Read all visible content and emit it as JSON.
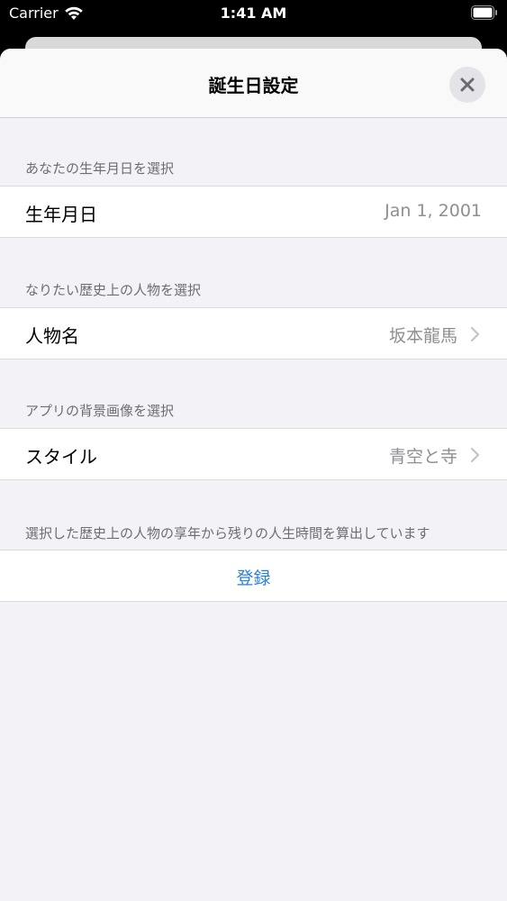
{
  "status_bar": {
    "carrier": "Carrier",
    "time": "1:41 AM"
  },
  "nav": {
    "title": "誕生日設定"
  },
  "sections": {
    "birthday_header": "あなたの生年月日を選択",
    "birthday_label": "生年月日",
    "birthday_value": "Jan 1, 2001",
    "person_header": "なりたい歴史上の人物を選択",
    "person_label": "人物名",
    "person_value": "坂本龍馬",
    "style_header": "アプリの背景画像を選択",
    "style_label": "スタイル",
    "style_value": "青空と寺"
  },
  "footer": {
    "note": "選択した歴史上の人物の享年から残りの人生時間を算出しています",
    "submit_label": "登録"
  },
  "colors": {
    "accent": "#2a7fd4",
    "background": "#f2f2f7",
    "secondary_text": "#8e8e93"
  }
}
